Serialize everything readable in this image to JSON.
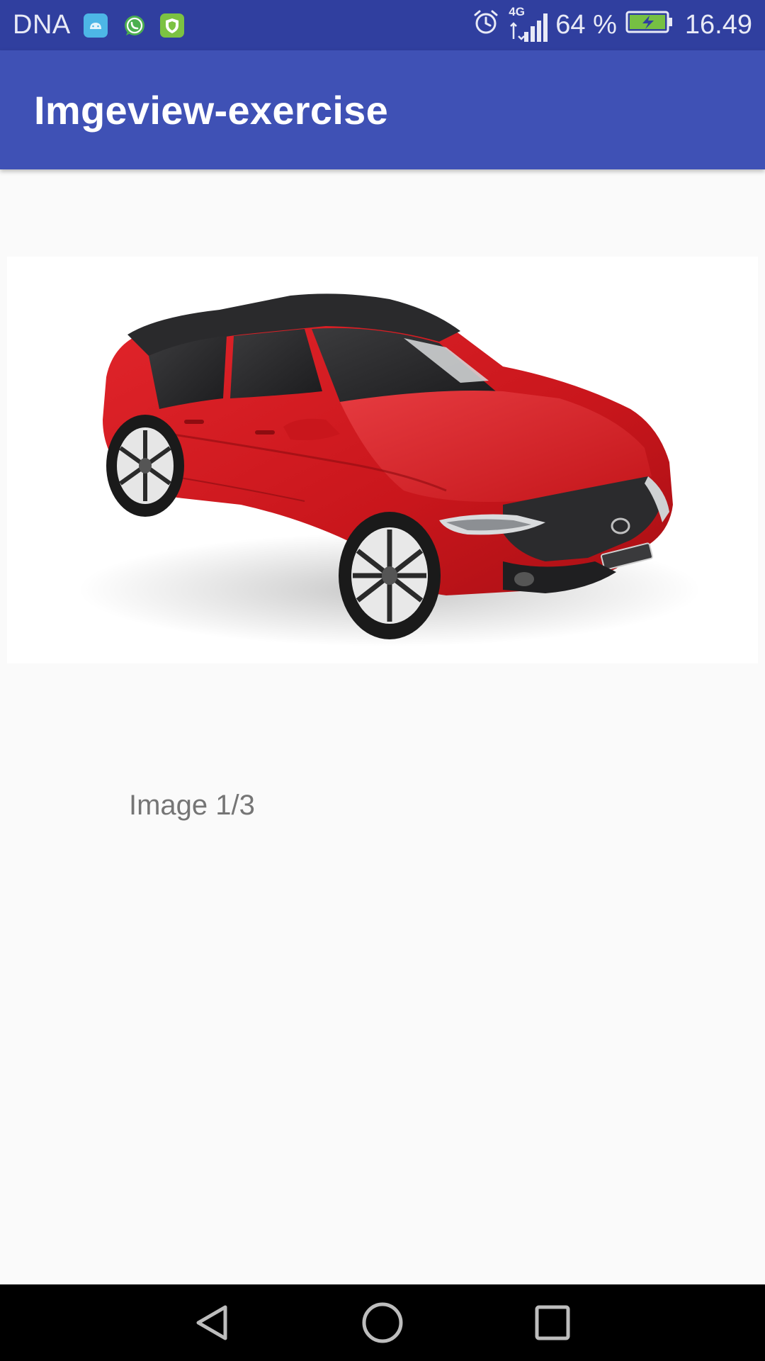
{
  "status_bar": {
    "carrier": "DNA",
    "notification_icons": [
      {
        "name": "android-app-icon",
        "color": "#4db6e6"
      },
      {
        "name": "whatsapp-icon",
        "color": "#4caf50"
      },
      {
        "name": "shield-app-icon",
        "color": "#7cc242"
      }
    ],
    "alarm_icon": "alarm-clock-icon",
    "network_type": "4G",
    "signal_icon": "signal-bars-icon",
    "battery_percent": "64 %",
    "battery_icon": "battery-charging-icon",
    "battery_color": "#76c043",
    "time": "16.49"
  },
  "app_bar": {
    "title": "Imgeview-exercise",
    "color": "#3f51b5",
    "status_color": "#303f9f"
  },
  "image_view": {
    "image": "red-hatchback-car-photo",
    "counter_text": "Image 1/3"
  },
  "nav_bar": {
    "back_icon": "back-triangle-icon",
    "home_icon": "home-circle-icon",
    "recents_icon": "recents-square-icon"
  }
}
